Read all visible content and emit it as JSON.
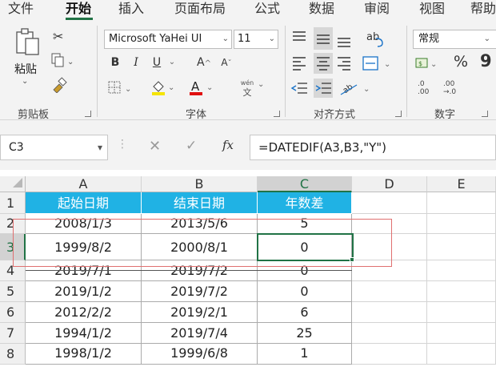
{
  "ribbon_tabs": [
    "文件",
    "开始",
    "插入",
    "页面布局",
    "公式",
    "数据",
    "审阅",
    "视图",
    "帮助"
  ],
  "active_tab": "开始",
  "clipboard": {
    "paste_label": "粘贴",
    "group_label": "剪贴板",
    "icons": [
      "paste-icon",
      "cut-icon",
      "copy-icon",
      "format-painter-icon"
    ]
  },
  "font": {
    "family": "Microsoft YaHei UI",
    "size": "11",
    "bold": "B",
    "italic": "I",
    "underline": "U",
    "grow": "A",
    "shrink": "A",
    "font_color": "A",
    "phonetic_top": "wén",
    "phonetic_bottom": "文",
    "group_label": "字体"
  },
  "alignment": {
    "group_label": "对齐方式",
    "wrap_glyph": "ab",
    "icons": [
      "align-top-icon",
      "align-middle-icon",
      "align-bottom-icon",
      "wrap-text-icon",
      "align-left-icon",
      "align-center-icon",
      "align-right-icon",
      "merge-center-icon",
      "decrease-indent-icon",
      "increase-indent-icon",
      "orientation-icon"
    ]
  },
  "number": {
    "format": "常规",
    "percent": "%",
    "comma": "9",
    "inc_decimal_top": ".0",
    "inc_decimal_bottom": ".00",
    "dec_decimal_top": ".00",
    "dec_decimal_bottom": "→.0",
    "group_label": "数字"
  },
  "formula_bar": {
    "name_box": "C3",
    "fx": "fx",
    "formula": "=DATEDIF(A3,B3,\"Y\")"
  },
  "sheet": {
    "columns": [
      "A",
      "B",
      "C",
      "D",
      "E"
    ],
    "active_column": "C",
    "active_row": "3",
    "rows": [
      {
        "num": "1",
        "a": "起始日期",
        "b": "结束日期",
        "c": "年数差"
      },
      {
        "num": "2",
        "a": "2008/1/3",
        "b": "2013/5/6",
        "c": "5"
      },
      {
        "num": "3",
        "a": "1999/8/2",
        "b": "2000/8/1",
        "c": "0"
      },
      {
        "num": "4",
        "a": "2019/7/1",
        "b": "2019/7/2",
        "c": "0"
      },
      {
        "num": "5",
        "a": "2019/1/2",
        "b": "2019/7/2",
        "c": "0"
      },
      {
        "num": "6",
        "a": "2012/2/2",
        "b": "2019/2/1",
        "c": "6"
      },
      {
        "num": "7",
        "a": "1994/1/2",
        "b": "2019/7/4",
        "c": "25"
      },
      {
        "num": "8",
        "a": "1998/1/2",
        "b": "1999/6/8",
        "c": "1"
      }
    ]
  },
  "colors": {
    "header_fill": "#20b2e4",
    "selection": "#217346",
    "annotation": "#e07070"
  }
}
